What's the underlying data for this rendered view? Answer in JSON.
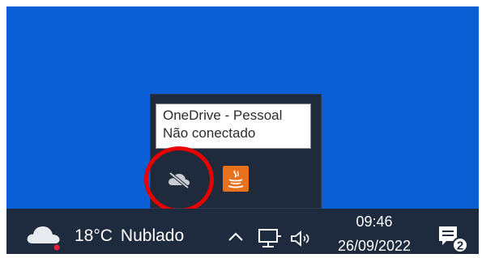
{
  "tooltip": {
    "title": "OneDrive - Pessoal",
    "status": "Não conectado"
  },
  "tray_overflow": {
    "icons": [
      "cloud-off-icon",
      "java-icon"
    ]
  },
  "taskbar": {
    "weather": {
      "icon": "cloudy-weather-icon",
      "temperature": "18°C",
      "condition": "Nublado"
    },
    "system_tray": {
      "chevron_icon": "chevron-up-icon",
      "network_icon": "network-icon",
      "volume_icon": "volume-icon"
    },
    "clock": {
      "time": "09:46",
      "date": "26/09/2022"
    },
    "notifications": {
      "icon": "notification-center-icon",
      "count": "2"
    }
  },
  "colors": {
    "desktop": "#0a5fd6",
    "taskbar": "#1e2a3d",
    "flyout": "#1f2b3d",
    "highlight_ring": "#e60000",
    "java_icon": "#e8711c"
  }
}
